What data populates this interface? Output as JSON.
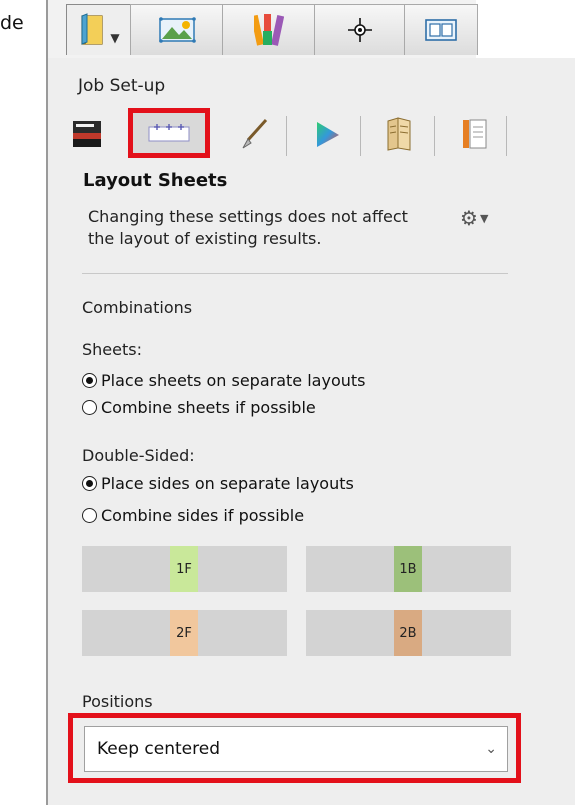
{
  "clipped_text": "de",
  "top_tabs": [
    {
      "icon": "job-book-icon",
      "has_dropdown": true
    },
    {
      "icon": "image-picture-icon"
    },
    {
      "icon": "color-swatches-icon"
    },
    {
      "icon": "crosshair-icon"
    },
    {
      "icon": "layout-frame-icon"
    }
  ],
  "section": "Job Set-up",
  "toolbar_icons": [
    "press-machine-icon",
    "layout-sheets-icon",
    "brush-icon",
    "color-gamut-icon",
    "folded-pages-icon",
    "document-pages-icon"
  ],
  "selected_toolbar_icon": "layout-sheets-icon",
  "panel": {
    "title": "Layout Sheets",
    "info": "Changing these settings does not affect the layout of existing results.",
    "gear_icon": "gear-icon"
  },
  "combinations": {
    "heading": "Combinations",
    "sheets_label": "Sheets:",
    "sheets_options": [
      "Place sheets on separate layouts",
      "Combine sheets if possible"
    ],
    "sheets_selected": 0,
    "double_sided_label": "Double-Sided:",
    "double_sided_options": [
      "Place sides on separate layouts",
      "Combine sides if possible"
    ],
    "double_sided_selected": 0
  },
  "preview": {
    "chips": [
      {
        "label": "1F",
        "color": "#c9e89a"
      },
      {
        "label": "1B",
        "color": "#9cc07a"
      },
      {
        "label": "2F",
        "color": "#f1c79d"
      },
      {
        "label": "2B",
        "color": "#d9aa82"
      }
    ]
  },
  "positions": {
    "heading": "Positions",
    "selected": "Keep centered"
  },
  "colors": {
    "highlight": "#e3101a"
  }
}
